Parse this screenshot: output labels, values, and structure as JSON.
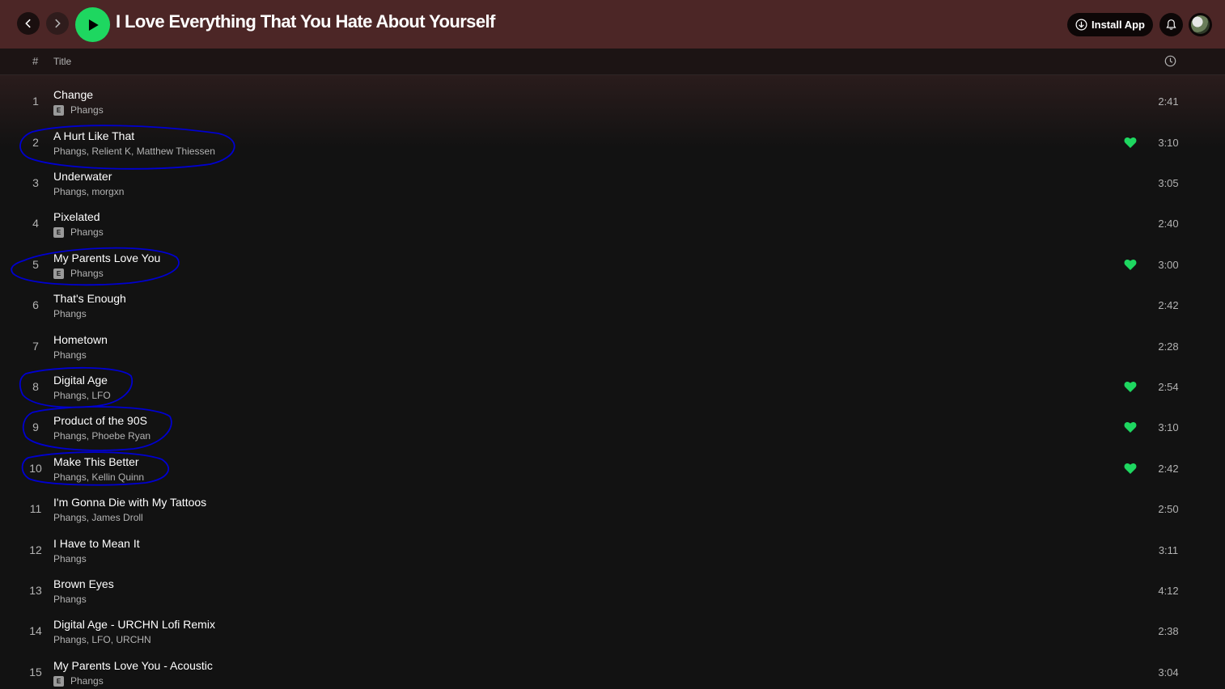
{
  "header": {
    "title": "I Love Everything That You Hate About Yourself",
    "install_label": "Install App"
  },
  "columns": {
    "number": "#",
    "title": "Title"
  },
  "colors": {
    "accent_green": "#1ed760",
    "header_bg": "#4c2626",
    "annotation_blue": "#0000d0"
  },
  "tracks": [
    {
      "number": "1",
      "title": "Change",
      "explicit": true,
      "artists": "Phangs",
      "liked": false,
      "duration": "2:41"
    },
    {
      "number": "2",
      "title": "A Hurt Like That",
      "explicit": false,
      "artists": "Phangs, Relient K, Matthew Thiessen",
      "liked": true,
      "duration": "3:10"
    },
    {
      "number": "3",
      "title": "Underwater",
      "explicit": false,
      "artists": "Phangs, morgxn",
      "liked": false,
      "duration": "3:05"
    },
    {
      "number": "4",
      "title": "Pixelated",
      "explicit": true,
      "artists": "Phangs",
      "liked": false,
      "duration": "2:40"
    },
    {
      "number": "5",
      "title": "My Parents Love You",
      "explicit": true,
      "artists": "Phangs",
      "liked": true,
      "duration": "3:00"
    },
    {
      "number": "6",
      "title": "That's Enough",
      "explicit": false,
      "artists": "Phangs",
      "liked": false,
      "duration": "2:42"
    },
    {
      "number": "7",
      "title": "Hometown",
      "explicit": false,
      "artists": "Phangs",
      "liked": false,
      "duration": "2:28"
    },
    {
      "number": "8",
      "title": "Digital Age",
      "explicit": false,
      "artists": "Phangs, LFO",
      "liked": true,
      "duration": "2:54"
    },
    {
      "number": "9",
      "title": "Product of the 90S",
      "explicit": false,
      "artists": "Phangs, Phoebe Ryan",
      "liked": true,
      "duration": "3:10"
    },
    {
      "number": "10",
      "title": "Make This Better",
      "explicit": false,
      "artists": "Phangs, Kellin Quinn",
      "liked": true,
      "duration": "2:42"
    },
    {
      "number": "11",
      "title": "I'm Gonna Die with My Tattoos",
      "explicit": false,
      "artists": "Phangs, James Droll",
      "liked": false,
      "duration": "2:50"
    },
    {
      "number": "12",
      "title": "I Have to Mean It",
      "explicit": false,
      "artists": "Phangs",
      "liked": false,
      "duration": "3:11"
    },
    {
      "number": "13",
      "title": "Brown Eyes",
      "explicit": false,
      "artists": "Phangs",
      "liked": false,
      "duration": "4:12"
    },
    {
      "number": "14",
      "title": "Digital Age - URCHN Lofi Remix",
      "explicit": false,
      "artists": "Phangs, LFO, URCHN",
      "liked": false,
      "duration": "2:38"
    },
    {
      "number": "15",
      "title": "My Parents Love You - Acoustic",
      "explicit": true,
      "artists": "Phangs",
      "liked": false,
      "duration": "3:04"
    }
  ]
}
